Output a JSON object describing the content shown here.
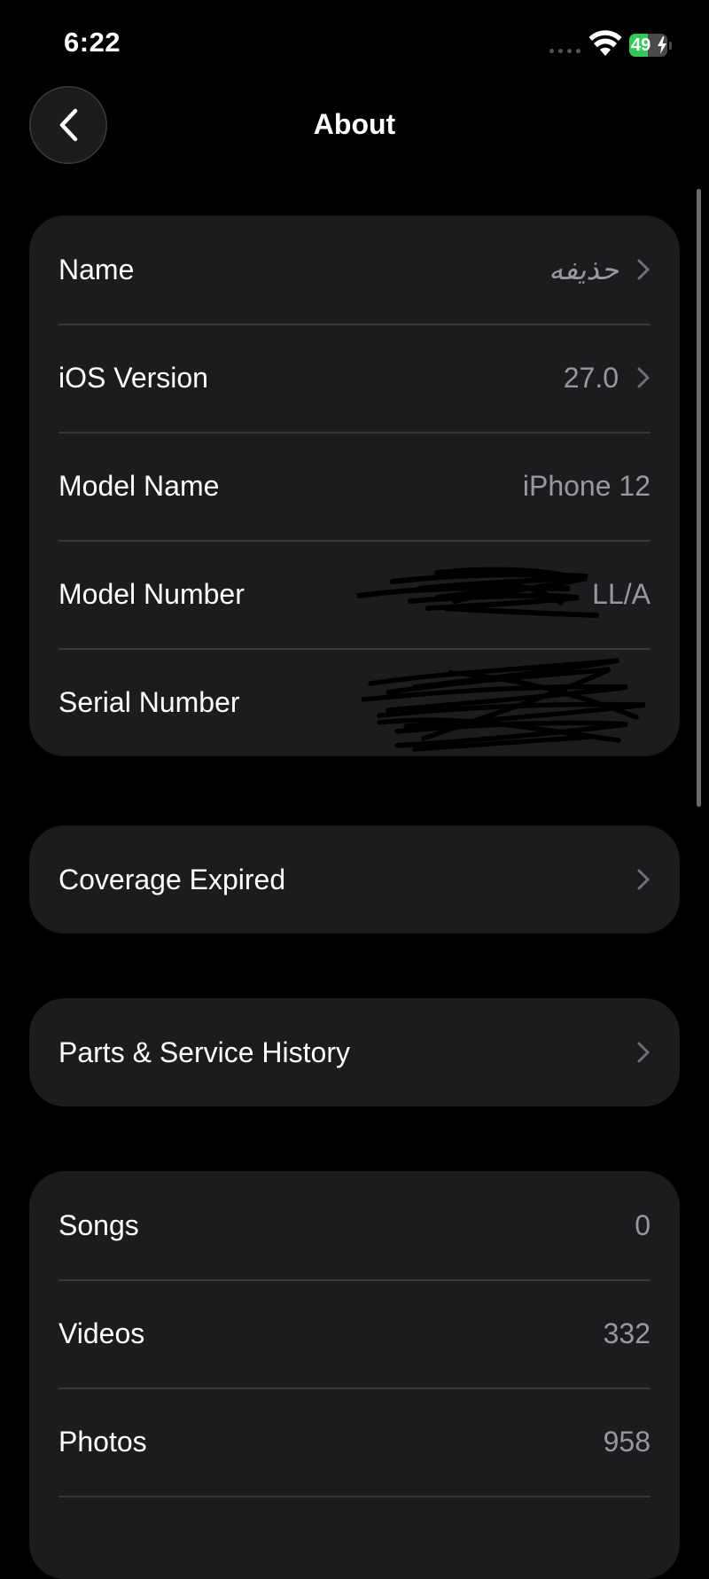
{
  "status_bar": {
    "time": "6:22",
    "battery_percent": 49,
    "battery_label": "49",
    "charging": true
  },
  "nav": {
    "title": "About",
    "back_icon": "chevron-left-icon"
  },
  "device_info": {
    "rows": [
      {
        "label": "Name",
        "value": "حذيفه",
        "has_chevron": true
      },
      {
        "label": "iOS Version",
        "value": "27.0",
        "has_chevron": true
      },
      {
        "label": "Model Name",
        "value": "iPhone 12",
        "has_chevron": false
      },
      {
        "label": "Model Number",
        "value": "LL/A",
        "has_chevron": false,
        "redacted": true
      },
      {
        "label": "Serial Number",
        "value": "",
        "has_chevron": false,
        "redacted": true
      }
    ]
  },
  "coverage": {
    "label": "Coverage Expired"
  },
  "parts_service": {
    "label": "Parts & Service History"
  },
  "media_counts": {
    "rows": [
      {
        "label": "Songs",
        "value": "0"
      },
      {
        "label": "Videos",
        "value": "332"
      },
      {
        "label": "Photos",
        "value": "958"
      }
    ]
  },
  "colors": {
    "background": "#000000",
    "card": "#1c1c1e",
    "secondary_text": "#98989e",
    "separator": "#38383a",
    "battery_green": "#33c759"
  }
}
